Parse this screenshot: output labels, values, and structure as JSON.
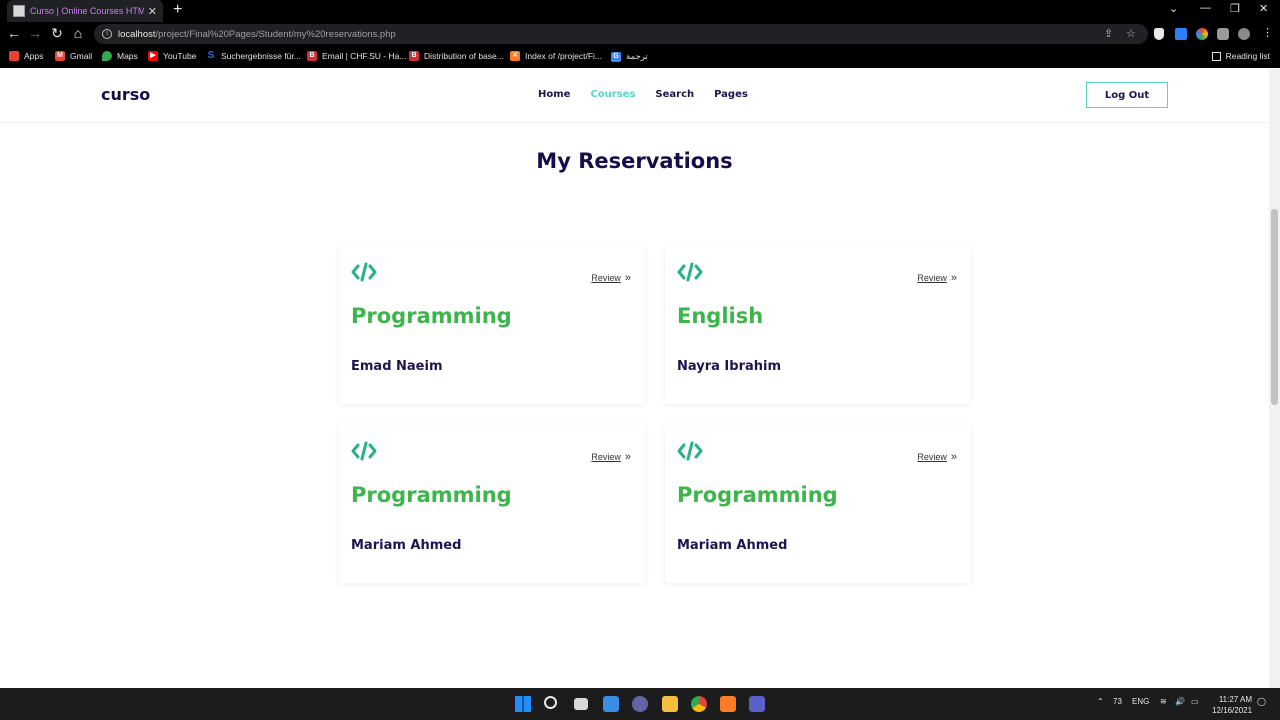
{
  "browser": {
    "tab_title": "Curso | Online Courses HTML5 Te",
    "new_tab": "+",
    "url_host": "localhost",
    "url_path": "/project/Final%20Pages/Student/my%20reservations.php",
    "bookmarks": [
      {
        "label": "Apps",
        "icon": "apps-grid-icon",
        "color": "#e94235"
      },
      {
        "label": "Gmail",
        "icon": "gmail-icon",
        "color": "#ea4335"
      },
      {
        "label": "Maps",
        "icon": "maps-pin-icon",
        "color": "#34a853"
      },
      {
        "label": "YouTube",
        "icon": "youtube-icon",
        "color": "#ff0000"
      },
      {
        "label": "Suchergebnisse für...",
        "icon": "s-icon",
        "color": "#2d6cdf"
      },
      {
        "label": "Email | CHF.SU - Ha...",
        "icon": "b-icon",
        "color": "#d32f2f"
      },
      {
        "label": "Distribution of base...",
        "icon": "b-icon",
        "color": "#d32f2f"
      },
      {
        "label": "Index of /project/Fi...",
        "icon": "xampp-icon",
        "color": "#fb7a24"
      },
      {
        "label": "ترجمة",
        "icon": "translate-icon",
        "color": "#4285f4"
      }
    ],
    "reading_list": "Reading list"
  },
  "site": {
    "logo": "curso",
    "nav": [
      {
        "label": "Home",
        "active": false
      },
      {
        "label": "Courses",
        "active": true
      },
      {
        "label": "Search",
        "active": false
      },
      {
        "label": "Pages",
        "active": false
      }
    ],
    "logout_label": "Log Out",
    "page_title": "My Reservations",
    "accent_color": "#5ad4c4",
    "course_color": "#3cb54a",
    "heading_color": "#140f4b"
  },
  "reservations": [
    {
      "course": "Programming",
      "teacher": "Emad Naeim",
      "review_label": "Review",
      "icon": "code-icon"
    },
    {
      "course": "English",
      "teacher": "Nayra Ibrahim",
      "review_label": "Review",
      "icon": "code-icon"
    },
    {
      "course": "Programming",
      "teacher": "Mariam Ahmed",
      "review_label": "Review",
      "icon": "code-icon"
    },
    {
      "course": "Programming",
      "teacher": "Mariam Ahmed",
      "review_label": "Review",
      "icon": "code-icon"
    }
  ],
  "taskbar": {
    "weather": "73",
    "language": "ENG",
    "time": "11:27 AM",
    "date": "12/16/2021"
  }
}
